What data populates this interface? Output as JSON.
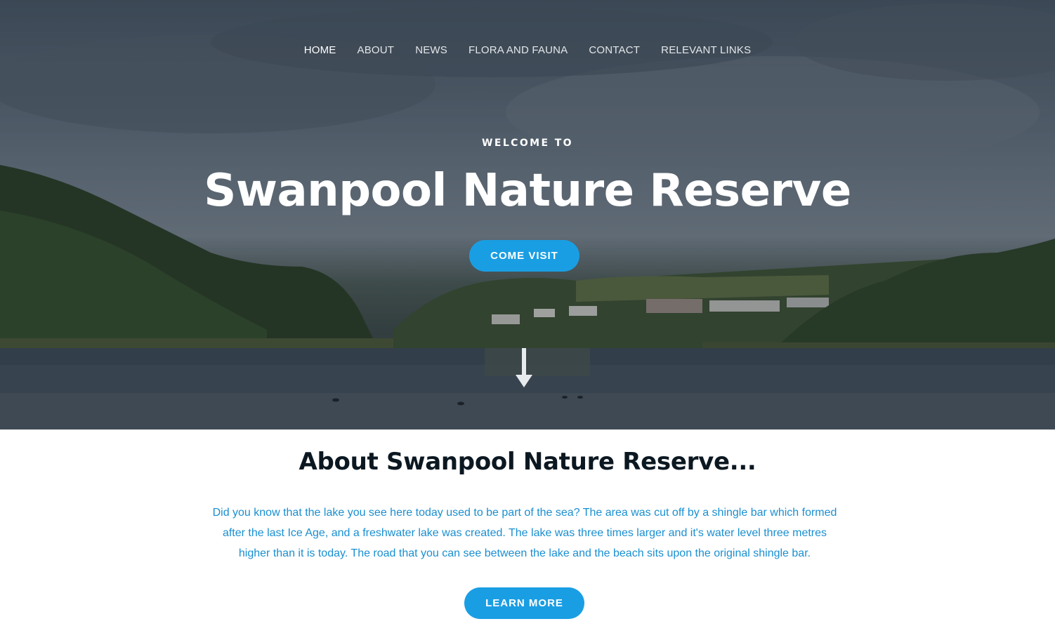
{
  "nav": {
    "items": [
      {
        "label": "HOME",
        "active": true
      },
      {
        "label": "ABOUT",
        "active": false
      },
      {
        "label": "NEWS",
        "active": false
      },
      {
        "label": "FLORA AND FAUNA",
        "active": false
      },
      {
        "label": "CONTACT",
        "active": false
      },
      {
        "label": "RELEVANT LINKS",
        "active": false
      }
    ]
  },
  "hero": {
    "welcome": "WELCOME TO",
    "title": "Swanpool Nature Reserve",
    "cta_label": "COME VISIT",
    "scroll_icon": "arrow-down-icon"
  },
  "about": {
    "heading": "About Swanpool Nature Reserve...",
    "body": "Did you know that the lake you see here today used to be part of the sea? The area was cut off by a shingle bar which formed after the last Ice Age, and a freshwater lake was created. The lake was three times larger and it's water level three metres higher than it is today. The road that you can see between the lake and the beach sits upon the original shingle bar.",
    "cta_label": "LEARN MORE"
  },
  "colors": {
    "accent": "#1a9ee3",
    "heading": "#0c1821",
    "body_text": "#1a8fd0"
  }
}
